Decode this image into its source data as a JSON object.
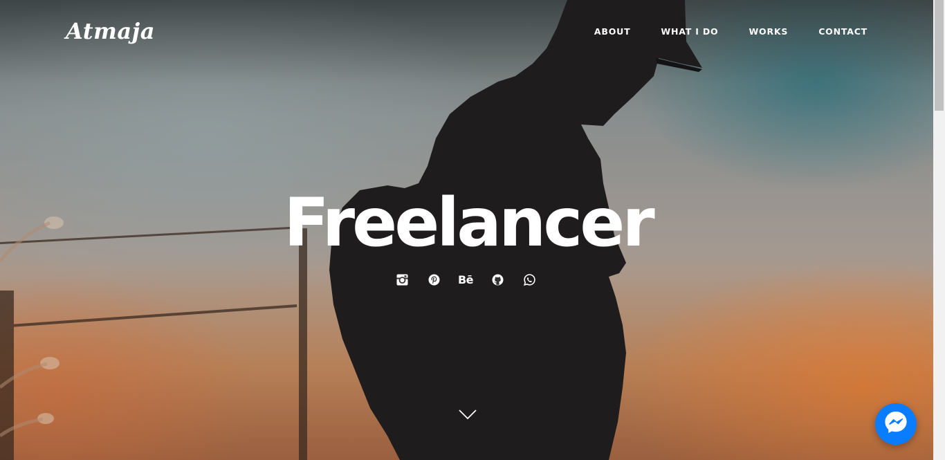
{
  "brand": {
    "logo_text": "Atmaja"
  },
  "nav": {
    "items": [
      {
        "label": "ABOUT"
      },
      {
        "label": "WHAT I DO"
      },
      {
        "label": "WORKS"
      },
      {
        "label": "CONTACT"
      }
    ]
  },
  "hero": {
    "title": "Freelancer",
    "socials": [
      {
        "icon": "instagram-icon"
      },
      {
        "icon": "pinterest-icon"
      },
      {
        "icon": "behance-icon",
        "text": "Bē"
      },
      {
        "icon": "github-icon"
      },
      {
        "icon": "whatsapp-icon"
      }
    ],
    "scroll_icon": "chevron-down-icon"
  },
  "widgets": {
    "chat_icon": "messenger-icon",
    "chat_color": "#0a7cff"
  }
}
